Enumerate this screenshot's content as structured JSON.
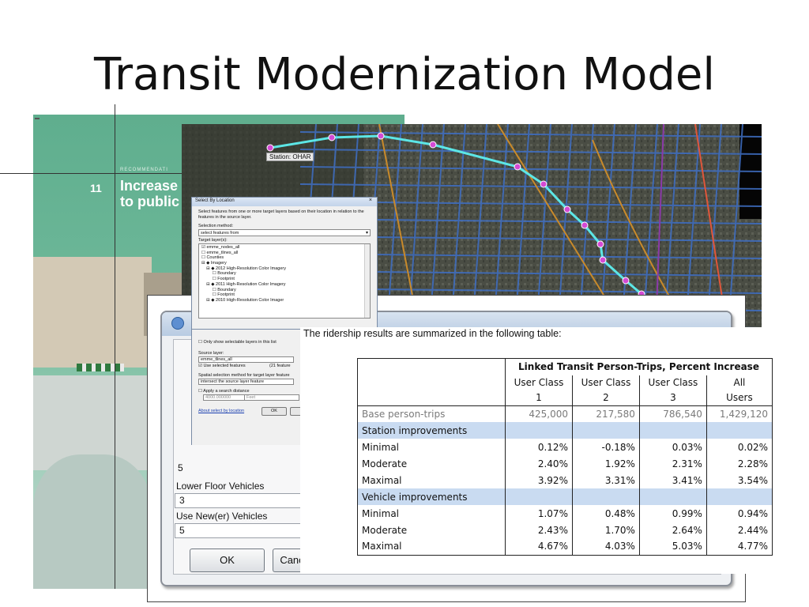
{
  "slide": {
    "title": "Transit Modernization Model"
  },
  "poster": {
    "rec_line": "RECOMMENDATI",
    "number": "11",
    "heading_line1": "Increase",
    "heading_line2": "to public"
  },
  "map": {
    "station_label": "Station: OHAR"
  },
  "select_by_location": {
    "title": "Select By Location",
    "close": "×",
    "description": "Select features from one or more target layers based on their location in relation to the features in the source layer.",
    "selection_method_label": "Selection method:",
    "selection_method_value": "select features from",
    "target_layers_label": "Target layer(s):",
    "layers": [
      "☑ emme_nodes_all",
      "☐ emme_tlines_all",
      "☐ Counties",
      "⊟ ◆ Imagery",
      "    ⊟ ◆ 2012 High-Resolution Color Imagery",
      "         ☐ Boundary",
      "         ☐ Footprint",
      "    ⊟ ◆ 2011 High-Resolution Color Imagery",
      "         ☐ Boundary",
      "         ☐ Footprint",
      "    ⊟ ◆ 2010 High-Resolution Color Imager"
    ],
    "only_selectable": "☐ Only show selectable layers in this list",
    "source_layer_label": "Source layer:",
    "source_layer_value": "emme_tlines_all",
    "use_selected": "☑ Use selected features",
    "feature_count": "(21 feature",
    "spatial_method_label": "Spatial selection method for target layer feature",
    "spatial_method_value": "intersect the source layer feature",
    "apply_distance": "☐ Apply a search distance",
    "distance_value": "4000.000000",
    "distance_unit": "Feet",
    "about_link": "About select by location",
    "ok": "OK"
  },
  "config_dialog": {
    "field_top_value": "5",
    "lower_floor_label": "Lower Floor Vehicles",
    "lower_floor_value": "3",
    "use_newer_label": "Use New(er) Vehicles",
    "use_newer_value": "5",
    "ok": "OK",
    "cancel": "Canc"
  },
  "results": {
    "caption": "The ridership results are summarized in the following table:",
    "group_header": "Linked Transit Person-Trips, Percent Increase",
    "columns": [
      [
        "User Class",
        "1"
      ],
      [
        "User Class",
        "2"
      ],
      [
        "User Class",
        "3"
      ],
      [
        "All",
        "Users"
      ]
    ],
    "rows": [
      {
        "label": "Base person-trips",
        "values": [
          "425,000",
          "217,580",
          "786,540",
          "1,429,120"
        ],
        "kind": "base"
      },
      {
        "label": "Station improvements",
        "values": [],
        "kind": "band"
      },
      {
        "label": "Minimal",
        "values": [
          "0.12%",
          "-0.18%",
          "0.03%",
          "0.02%"
        ],
        "kind": "data"
      },
      {
        "label": "Moderate",
        "values": [
          "2.40%",
          "1.92%",
          "2.31%",
          "2.28%"
        ],
        "kind": "data"
      },
      {
        "label": "Maximal",
        "values": [
          "3.92%",
          "3.31%",
          "3.41%",
          "3.54%"
        ],
        "kind": "data"
      },
      {
        "label": "Vehicle improvements",
        "values": [],
        "kind": "band"
      },
      {
        "label": "Minimal",
        "values": [
          "1.07%",
          "0.48%",
          "0.99%",
          "0.94%"
        ],
        "kind": "data"
      },
      {
        "label": "Moderate",
        "values": [
          "2.43%",
          "1.70%",
          "2.64%",
          "2.44%"
        ],
        "kind": "data"
      },
      {
        "label": "Maximal",
        "values": [
          "4.67%",
          "4.03%",
          "5.03%",
          "4.77%"
        ],
        "kind": "data"
      }
    ]
  }
}
